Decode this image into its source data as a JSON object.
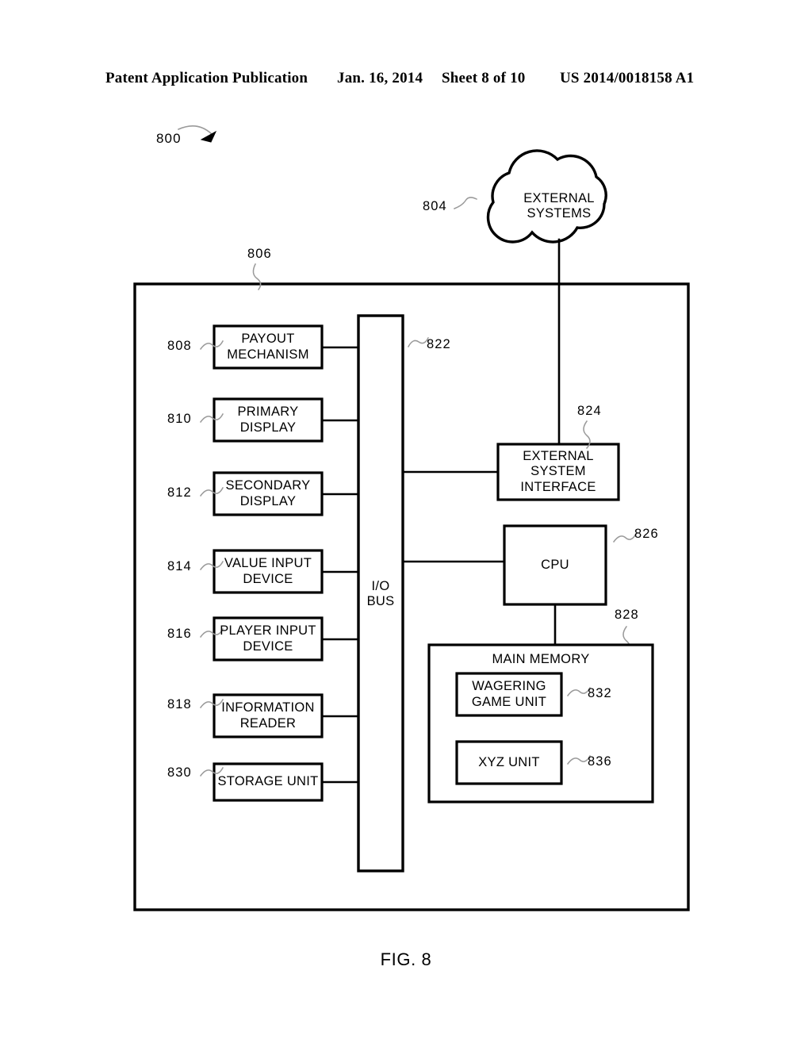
{
  "header": {
    "publication": "Patent Application Publication",
    "date": "Jan. 16, 2014",
    "sheet": "Sheet 8 of 10",
    "patent_number": "US 2014/0018158 A1"
  },
  "figure": {
    "caption": "FIG. 8",
    "figure_ref": "800",
    "enclosure_ref": "806",
    "cloud": {
      "label": "EXTERNAL\nSYSTEMS",
      "ref": "804"
    },
    "bus": {
      "label": "I/O\nBUS",
      "ref": "822"
    },
    "left_blocks": [
      {
        "ref": "808",
        "label": "PAYOUT\nMECHANISM"
      },
      {
        "ref": "810",
        "label": "PRIMARY\nDISPLAY"
      },
      {
        "ref": "812",
        "label": "SECONDARY\nDISPLAY"
      },
      {
        "ref": "814",
        "label": "VALUE INPUT\nDEVICE"
      },
      {
        "ref": "816",
        "label": "PLAYER INPUT\nDEVICE"
      },
      {
        "ref": "818",
        "label": "INFORMATION\nREADER"
      },
      {
        "ref": "830",
        "label": "STORAGE UNIT"
      }
    ],
    "right_blocks": [
      {
        "ref": "824",
        "label": "EXTERNAL\nSYSTEM\nINTERFACE"
      },
      {
        "ref": "826",
        "label": "CPU"
      }
    ],
    "main_memory": {
      "ref": "828",
      "label": "MAIN MEMORY",
      "units": [
        {
          "ref": "832",
          "label": "WAGERING\nGAME UNIT"
        },
        {
          "ref": "836",
          "label": "XYZ UNIT"
        }
      ]
    }
  },
  "colors": {
    "ink": "#000000",
    "paper": "#ffffff",
    "leader": "#9a9a9a"
  }
}
